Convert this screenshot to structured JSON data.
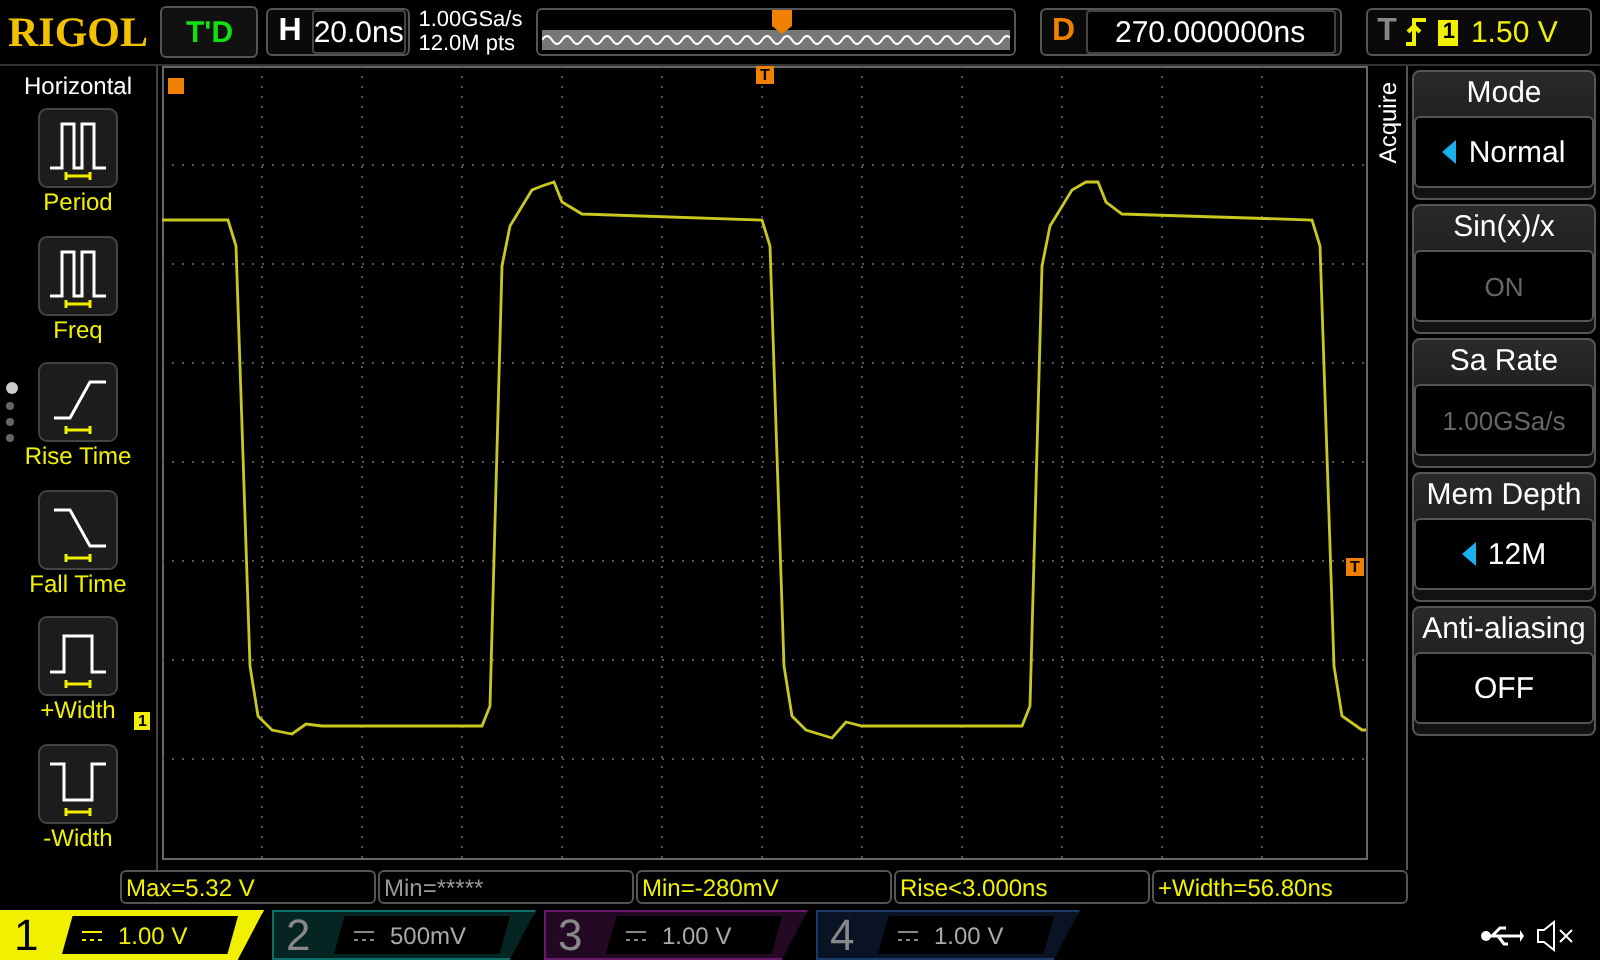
{
  "header": {
    "logo": "RIGOL",
    "run_state": "T'D",
    "timebase": {
      "label": "H",
      "value": "20.0ns"
    },
    "sample_rate": "1.00GSa/s",
    "memory": "12.0M pts",
    "delay": {
      "label": "D",
      "value": "270.000000ns"
    },
    "trigger": {
      "label": "T",
      "channel": "1",
      "level": "1.50 V"
    }
  },
  "sidebar": {
    "title": "Horizontal",
    "items": [
      {
        "label": "Period",
        "kind": "period"
      },
      {
        "label": "Freq",
        "kind": "freq"
      },
      {
        "label": "Rise Time",
        "kind": "rise"
      },
      {
        "label": "Fall Time",
        "kind": "fall"
      },
      {
        "label": "+Width",
        "kind": "pwidth"
      },
      {
        "label": "-Width",
        "kind": "nwidth"
      }
    ],
    "pages": [
      {
        "selected": true
      },
      {
        "selected": false
      },
      {
        "selected": false
      },
      {
        "selected": false
      }
    ]
  },
  "markers": {
    "trigger_position": "T",
    "channel": "1",
    "trigger_level": "T"
  },
  "menu": {
    "title": "Acquire",
    "items": [
      {
        "label": "Mode",
        "value": "Normal",
        "kind": "select",
        "disabled": false
      },
      {
        "label": "Sin(x)/x",
        "value": "ON",
        "kind": "toggle",
        "disabled": true
      },
      {
        "label": "Sa Rate",
        "value": "1.00GSa/s",
        "kind": "readout",
        "disabled": true
      },
      {
        "label": "Mem Depth",
        "value": "12M",
        "kind": "select",
        "disabled": false
      },
      {
        "label": "Anti-aliasing",
        "value": "OFF",
        "kind": "toggle",
        "disabled": false
      }
    ]
  },
  "measurements": [
    {
      "text": "Max=5.32 V",
      "valid": true
    },
    {
      "text": "Min=*****",
      "valid": false
    },
    {
      "text": "Min=-280mV",
      "valid": true
    },
    {
      "text": "Rise<3.000ns",
      "valid": true
    },
    {
      "text": "+Width=56.80ns",
      "valid": true
    }
  ],
  "channels": [
    {
      "number": "1",
      "scale": "1.00 V",
      "on": true,
      "color": "#f0f000"
    },
    {
      "number": "2",
      "scale": "500mV",
      "on": false,
      "color": "#0e6e6a"
    },
    {
      "number": "3",
      "scale": "1.00 V",
      "on": false,
      "color": "#6a1a6a"
    },
    {
      "number": "4",
      "scale": "1.00 V",
      "on": false,
      "color": "#1a3a6a"
    }
  ]
}
